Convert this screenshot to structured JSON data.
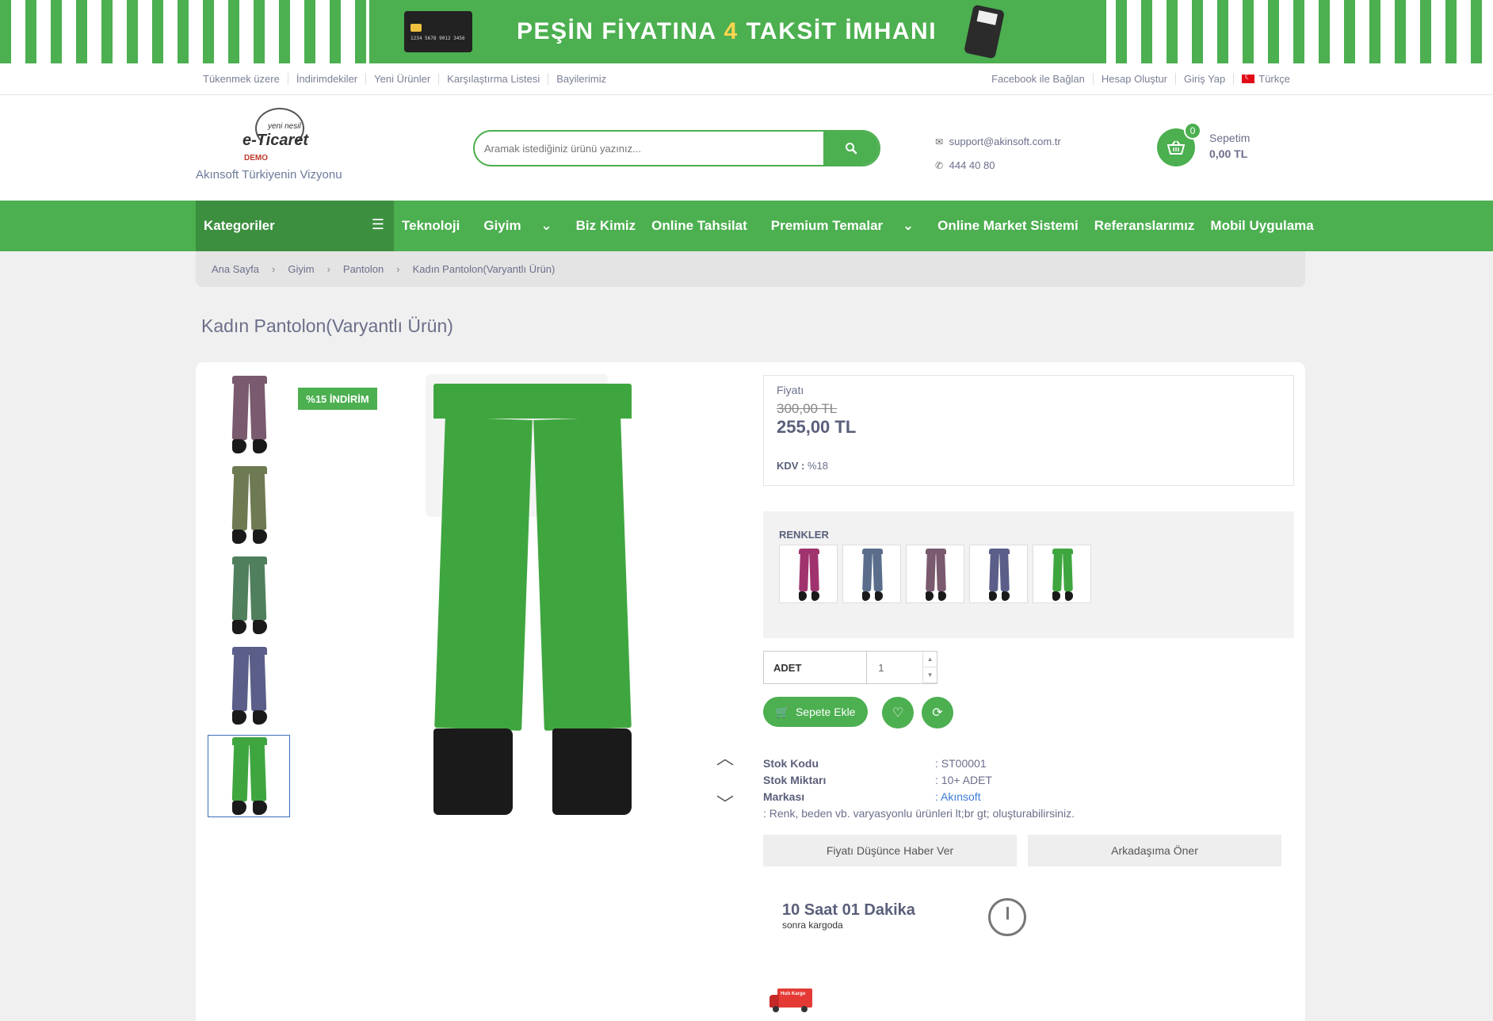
{
  "banner": {
    "text_before": "PEŞİN FİYATINA ",
    "text_number": "4",
    "text_after": " TAKSİT İMHANI",
    "card_number": "1234 5678 9012 3456"
  },
  "topbar": {
    "left_links": [
      "Tükenmek üzere",
      "İndirimdekiler",
      "Yeni Ürünler",
      "Karşılaştırma Listesi",
      "Bayilerimiz"
    ],
    "facebook": "Facebook ile Bağlan",
    "register": "Hesap Oluştur",
    "login": "Giriş Yap",
    "language": "Türkçe"
  },
  "header": {
    "logo_small": "yeni nesil",
    "logo_main": "e-Ticaret",
    "logo_demo": "DEMO",
    "tagline": "Akınsoft Türkiyenin Vizyonu",
    "search_placeholder": "Aramak istediğiniz ürünü yazınız...",
    "email": "support@akinsoft.com.tr",
    "phone": "444 40 80",
    "cart_count": "0",
    "cart_label": "Sepetim",
    "cart_total": "0,00 TL"
  },
  "nav": {
    "categories": "Kategoriler",
    "items": [
      "Teknoloji",
      "Giyim",
      "Biz Kimiz",
      "Online Tahsilat",
      "Premium Temalar",
      "Online Market Sistemi",
      "Referanslarımız",
      "Mobil Uygulama"
    ]
  },
  "breadcrumb": [
    "Ana Sayfa",
    "Giyim",
    "Pantolon",
    "Kadın Pantolon(Varyantlı Ürün)"
  ],
  "product": {
    "title": "Kadın Pantolon(Varyantlı Ürün)",
    "discount_badge": "%15 İNDİRİM",
    "price_label": "Fiyatı",
    "old_price": "300,00 TL",
    "new_price": "255,00 TL",
    "kdv_label": "KDV :",
    "kdv_value": "%18",
    "colors_label": "RENKLER",
    "thumb_colors": [
      "#7a5a6e",
      "#6e7a52",
      "#4f7f5c",
      "#5a5e88",
      "#3fa63f"
    ],
    "swatch_colors": [
      "#a0336e",
      "#5a6e8c",
      "#7a5a6e",
      "#5a5e88",
      "#3fa63f"
    ],
    "main_color": "#3fa63f",
    "qty_label": "ADET",
    "qty_value": "1",
    "add_to_cart": "Sepete Ekle",
    "specs": [
      {
        "label": "Stok Kodu",
        "value": ": ST00001"
      },
      {
        "label": "Stok Miktarı",
        "value": ": 10+ ADET"
      },
      {
        "label": "Markası",
        "value": ": Akınsoft"
      }
    ],
    "description": ": Renk, beden vb. varyasyonlu ürünleri lt;br gt; oluşturabilirsiniz.",
    "notify_button": "Fiyatı Düşünce Haber Ver",
    "share_button": "Arkadaşıma Öner",
    "countdown": "10 Saat 01 Dakika",
    "countdown_sub": "sonra kargoda",
    "truck_text": "Hızlı Kargo"
  },
  "colors": {
    "brand_green": "#4caf50",
    "dark_green": "#3d8f40",
    "link_blue": "#3b7dd8"
  }
}
